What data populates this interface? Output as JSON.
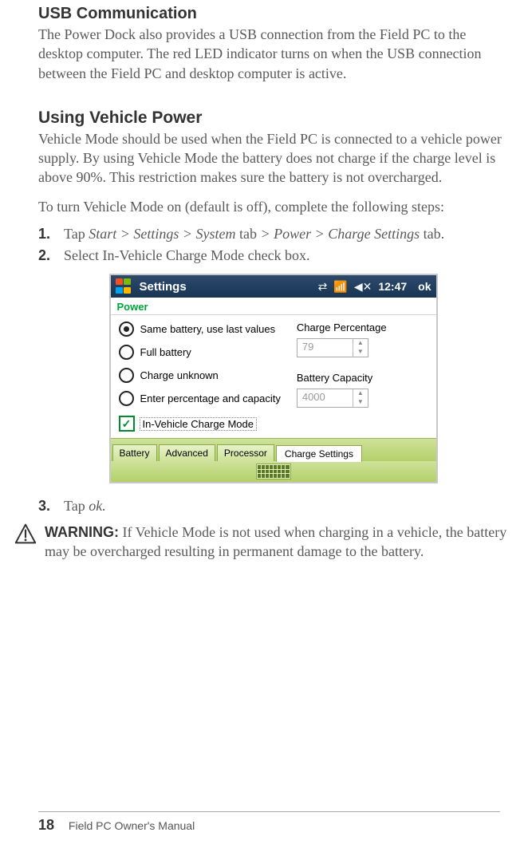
{
  "section1": {
    "title": "USB Communication",
    "body": "The Power Dock also provides a USB connection from the Field PC to the desktop computer. The red LED indicator turns on when the USB connection between the Field PC and desktop computer is active."
  },
  "section2": {
    "title": "Using Vehicle Power",
    "body1": "Vehicle Mode should be used when the Field PC is connected to a vehicle power supply. By using Vehicle Mode the battery does not charge if the charge level is above 90%. This restriction makes sure the battery is not overcharged.",
    "body2": "To turn Vehicle Mode on (default is off), complete the following steps:"
  },
  "steps": {
    "s1_a": "Tap ",
    "s1_b": "Start > Settings > System ",
    "s1_c": "tab",
    "s1_d": " > Power > Charge Settings ",
    "s1_e": "tab.",
    "s2_a": "Select ",
    "s2_b": "In-Vehicle Charge Mode ",
    "s2_c": "check box.",
    "s3_a": "Tap ",
    "s3_b": "ok."
  },
  "shot": {
    "title": "Settings",
    "time": "12:47",
    "ok": "ok",
    "power": "Power",
    "radios": {
      "r1": "Same battery, use last values",
      "r2": "Full battery",
      "r3": "Charge unknown",
      "r4": "Enter percentage and capacity"
    },
    "fields": {
      "cp_label": "Charge Percentage",
      "cp_val": "79",
      "bc_label": "Battery Capacity",
      "bc_val": "4000"
    },
    "check_label": "In-Vehicle Charge Mode",
    "tabs": {
      "t1": "Battery",
      "t2": "Advanced",
      "t3": "Processor",
      "t4": "Charge Settings"
    }
  },
  "warning": {
    "label": "WARNING:",
    "text": "  If Vehicle Mode is not used when charging in a vehicle, the battery may be overcharged resulting in permanent damage to the battery."
  },
  "footer": {
    "page": "18",
    "title": "Field PC Owner's Manual"
  }
}
